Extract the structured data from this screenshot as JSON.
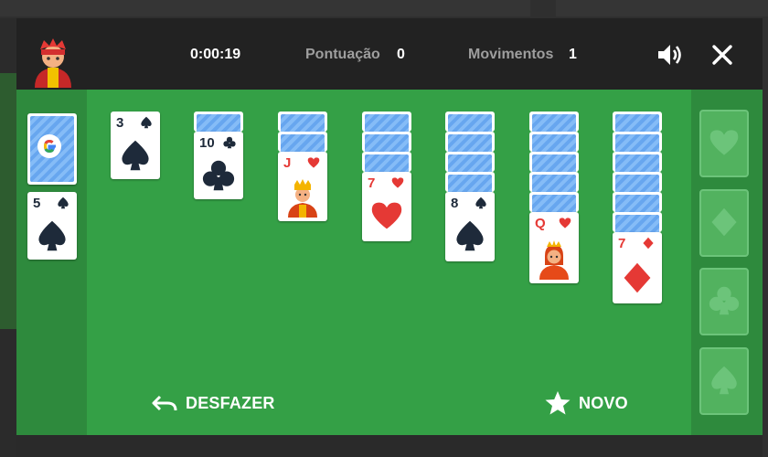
{
  "header": {
    "timer": "0:00:19",
    "score_label": "Pontuação",
    "score_value": "0",
    "moves_label": "Movimentos",
    "moves_value": "1"
  },
  "actions": {
    "undo_label": "DESFAZER",
    "new_label": "NOVO"
  },
  "waste_card": {
    "rank": "5",
    "suit": "spade"
  },
  "tableau": [
    {
      "face_down": 0,
      "top": {
        "rank": "3",
        "suit": "spade"
      }
    },
    {
      "face_down": 1,
      "top": {
        "rank": "10",
        "suit": "club"
      }
    },
    {
      "face_down": 2,
      "top": {
        "rank": "J",
        "suit": "heart"
      }
    },
    {
      "face_down": 3,
      "top": {
        "rank": "7",
        "suit": "heart"
      }
    },
    {
      "face_down": 4,
      "top": {
        "rank": "8",
        "suit": "spade"
      }
    },
    {
      "face_down": 5,
      "top": {
        "rank": "Q",
        "suit": "heart"
      }
    },
    {
      "face_down": 6,
      "top": {
        "rank": "7",
        "suit": "diamond"
      }
    }
  ],
  "foundations": [
    "heart",
    "diamond",
    "club",
    "spade"
  ],
  "colors": {
    "board": "#34a046",
    "red_suit": "#e53935",
    "black_suit": "#1e2a3a",
    "card_back": "#67a6ef"
  },
  "icons": [
    "mascot-icon",
    "volume-icon",
    "close-icon",
    "undo-icon",
    "star-icon",
    "google-g-icon"
  ]
}
